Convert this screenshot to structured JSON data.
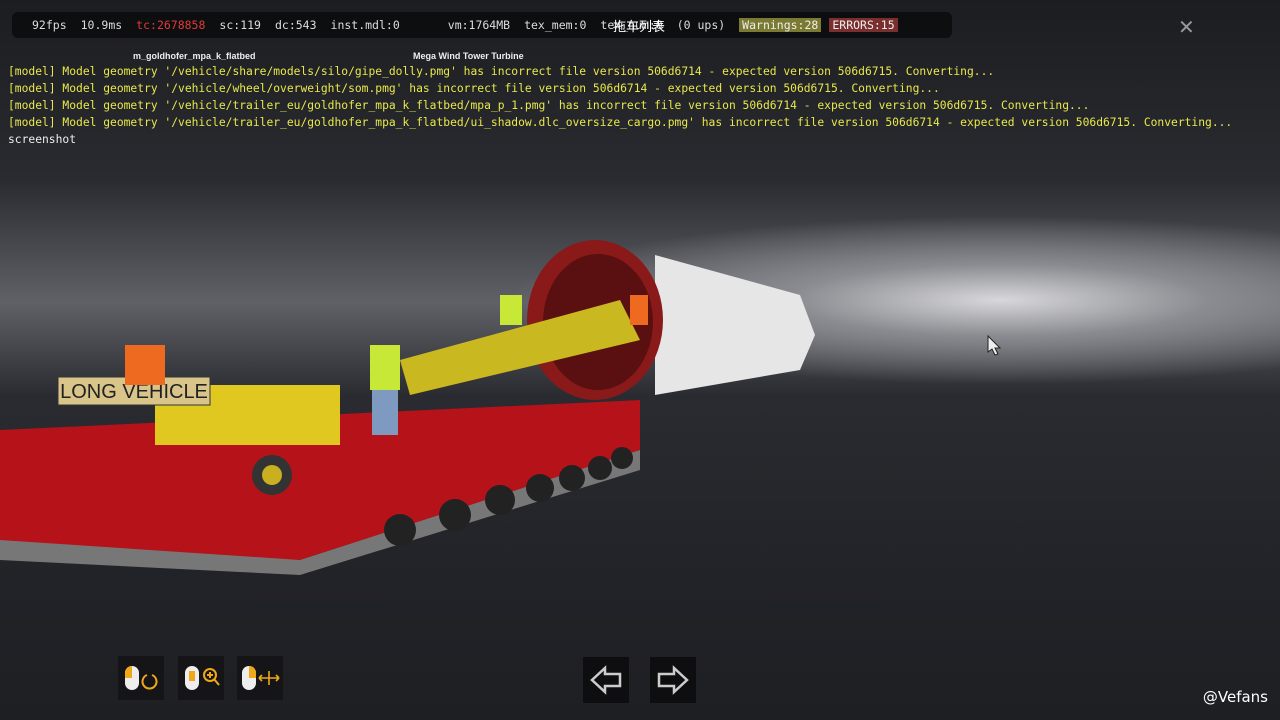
{
  "stats": {
    "fps": "92fps",
    "frame_time": "10.9ms",
    "tc": "tc:2678858",
    "sc": "sc:119",
    "dc": "dc:543",
    "inst_mdl": "inst.mdl:0",
    "vm": "vm:1764MB",
    "tex_mem": "tex_mem:0",
    "tex_num": "tex_num:0",
    "ups": "(0 ups)",
    "warnings": "Warnings:28",
    "errors": "ERRORS:15"
  },
  "overlay_title": "拖车列表",
  "console": [
    "[model] Model geometry '/vehicle/share/models/silo/gipe_dolly.pmg' has incorrect file version 506d6714 - expected version 506d6715. Converting...",
    "[model] Model geometry '/vehicle/wheel/overweight/som.pmg' has incorrect file version 506d6714 - expected version 506d6715. Converting...",
    "[model] Model geometry '/vehicle/trailer_eu/goldhofer_mpa_k_flatbed/mpa_p_1.pmg' has incorrect file version 506d6714 - expected version 506d6715. Converting...",
    "[model] Model geometry '/vehicle/trailer_eu/goldhofer_mpa_k_flatbed/ui_shadow.dlc_oversize_cargo.pmg' has incorrect file version 506d6714 - expected version 506d6715. Converting..."
  ],
  "console_last": "screenshot",
  "labels": {
    "trailer": "m_goldhofer_mpa_k_flatbed",
    "cargo": "Mega Wind Tower Turbine",
    "sign": "LONG VEHICLE"
  },
  "watermark": "@Vefans",
  "colors": {
    "accent": "#f0a818",
    "trailer_red": "#c8151e"
  }
}
